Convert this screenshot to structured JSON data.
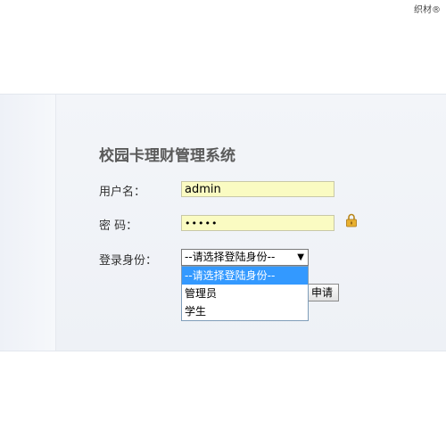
{
  "watermark": "织材®",
  "form": {
    "title": "校园卡理财管理系统",
    "username_label": "用户名：",
    "username_value": "admin",
    "password_label": "密 码：",
    "password_value": "•••••",
    "role_label": "登录身份：",
    "role_selected": "--请选择登陆身份--",
    "role_options": [
      "--请选择登陆身份--",
      "管理员",
      "学生"
    ],
    "apply_button_label": "申请"
  },
  "icons": {
    "password": "lock-icon",
    "select": "caret-down-icon"
  },
  "colors": {
    "input_bg": "#fafbc2",
    "selected_option": "#3399ff",
    "panel_bg": "#f0f3f8",
    "lock": "#e0a020"
  }
}
